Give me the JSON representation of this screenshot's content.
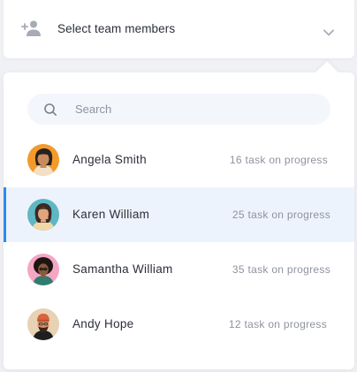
{
  "selector": {
    "label": "Select team members",
    "icon": "add-user-icon",
    "chevron_icon": "chevron-down-icon"
  },
  "search": {
    "placeholder": "Search",
    "value": ""
  },
  "colors": {
    "accent": "#2a8bf2",
    "active_row_bg": "#edf3fc",
    "muted_text": "#8e939f",
    "primary_text": "#2b2f3a"
  },
  "members": [
    {
      "name": "Angela Smith",
      "progress": "16 task on progress",
      "selected": false,
      "avatar_bg": "#f39a2b"
    },
    {
      "name": "Karen William",
      "progress": "25 task on progress",
      "selected": true,
      "avatar_bg": "#5fb7c4"
    },
    {
      "name": "Samantha William",
      "progress": "35 task on progress",
      "selected": false,
      "avatar_bg": "#f4a6c4"
    },
    {
      "name": "Andy Hope",
      "progress": "12 task on progress",
      "selected": false,
      "avatar_bg": "#e8d2b4"
    }
  ]
}
